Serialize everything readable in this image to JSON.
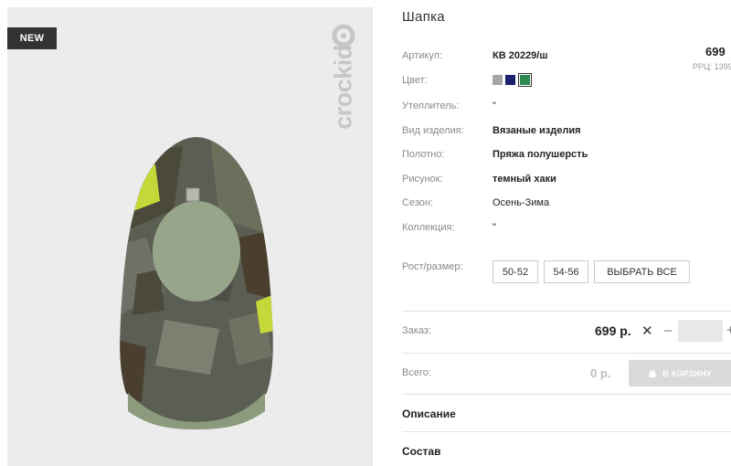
{
  "badge": "NEW",
  "brand": "crockid",
  "product": {
    "title": "Шапка",
    "price_top": "699",
    "rrp": "РРЦ: 1399"
  },
  "specs": [
    {
      "label": "Артикул:",
      "value": "КВ 20229/ш"
    },
    {
      "label": "Цвет:",
      "value": ""
    },
    {
      "label": "Утеплитель:",
      "value": "\""
    },
    {
      "label": "Вид изделия:",
      "value": "Вязаные изделия"
    },
    {
      "label": "Полотно:",
      "value": "Пряжа полушерсть"
    },
    {
      "label": "Рисунок:",
      "value": "темный хаки"
    },
    {
      "label": "Сезон:",
      "value": "Осень-Зима"
    },
    {
      "label": "Коллекция:",
      "value": "\""
    }
  ],
  "swatches": [
    {
      "color": "#a6a6a6",
      "selected": false
    },
    {
      "color": "#1a1f6e",
      "selected": false
    },
    {
      "color": "#2e8a55",
      "selected": true
    }
  ],
  "size_label": "Рост/размер:",
  "sizes": [
    "50-52",
    "54-56"
  ],
  "select_all": "ВЫБРАТЬ ВСЕ",
  "order": {
    "label": "Заказ:",
    "price": "699 р.",
    "times": "✕",
    "minus": "–",
    "plus": "+",
    "qty": ""
  },
  "total": {
    "label": "Всего:",
    "value": "0 р.",
    "cart_button": "В КОРЗИНУ"
  },
  "sections": [
    "Описание",
    "Состав"
  ],
  "colors": {
    "badge_bg": "#333333",
    "gallery_bg": "#ececec",
    "cart_disabled": "#d9d9d9"
  }
}
